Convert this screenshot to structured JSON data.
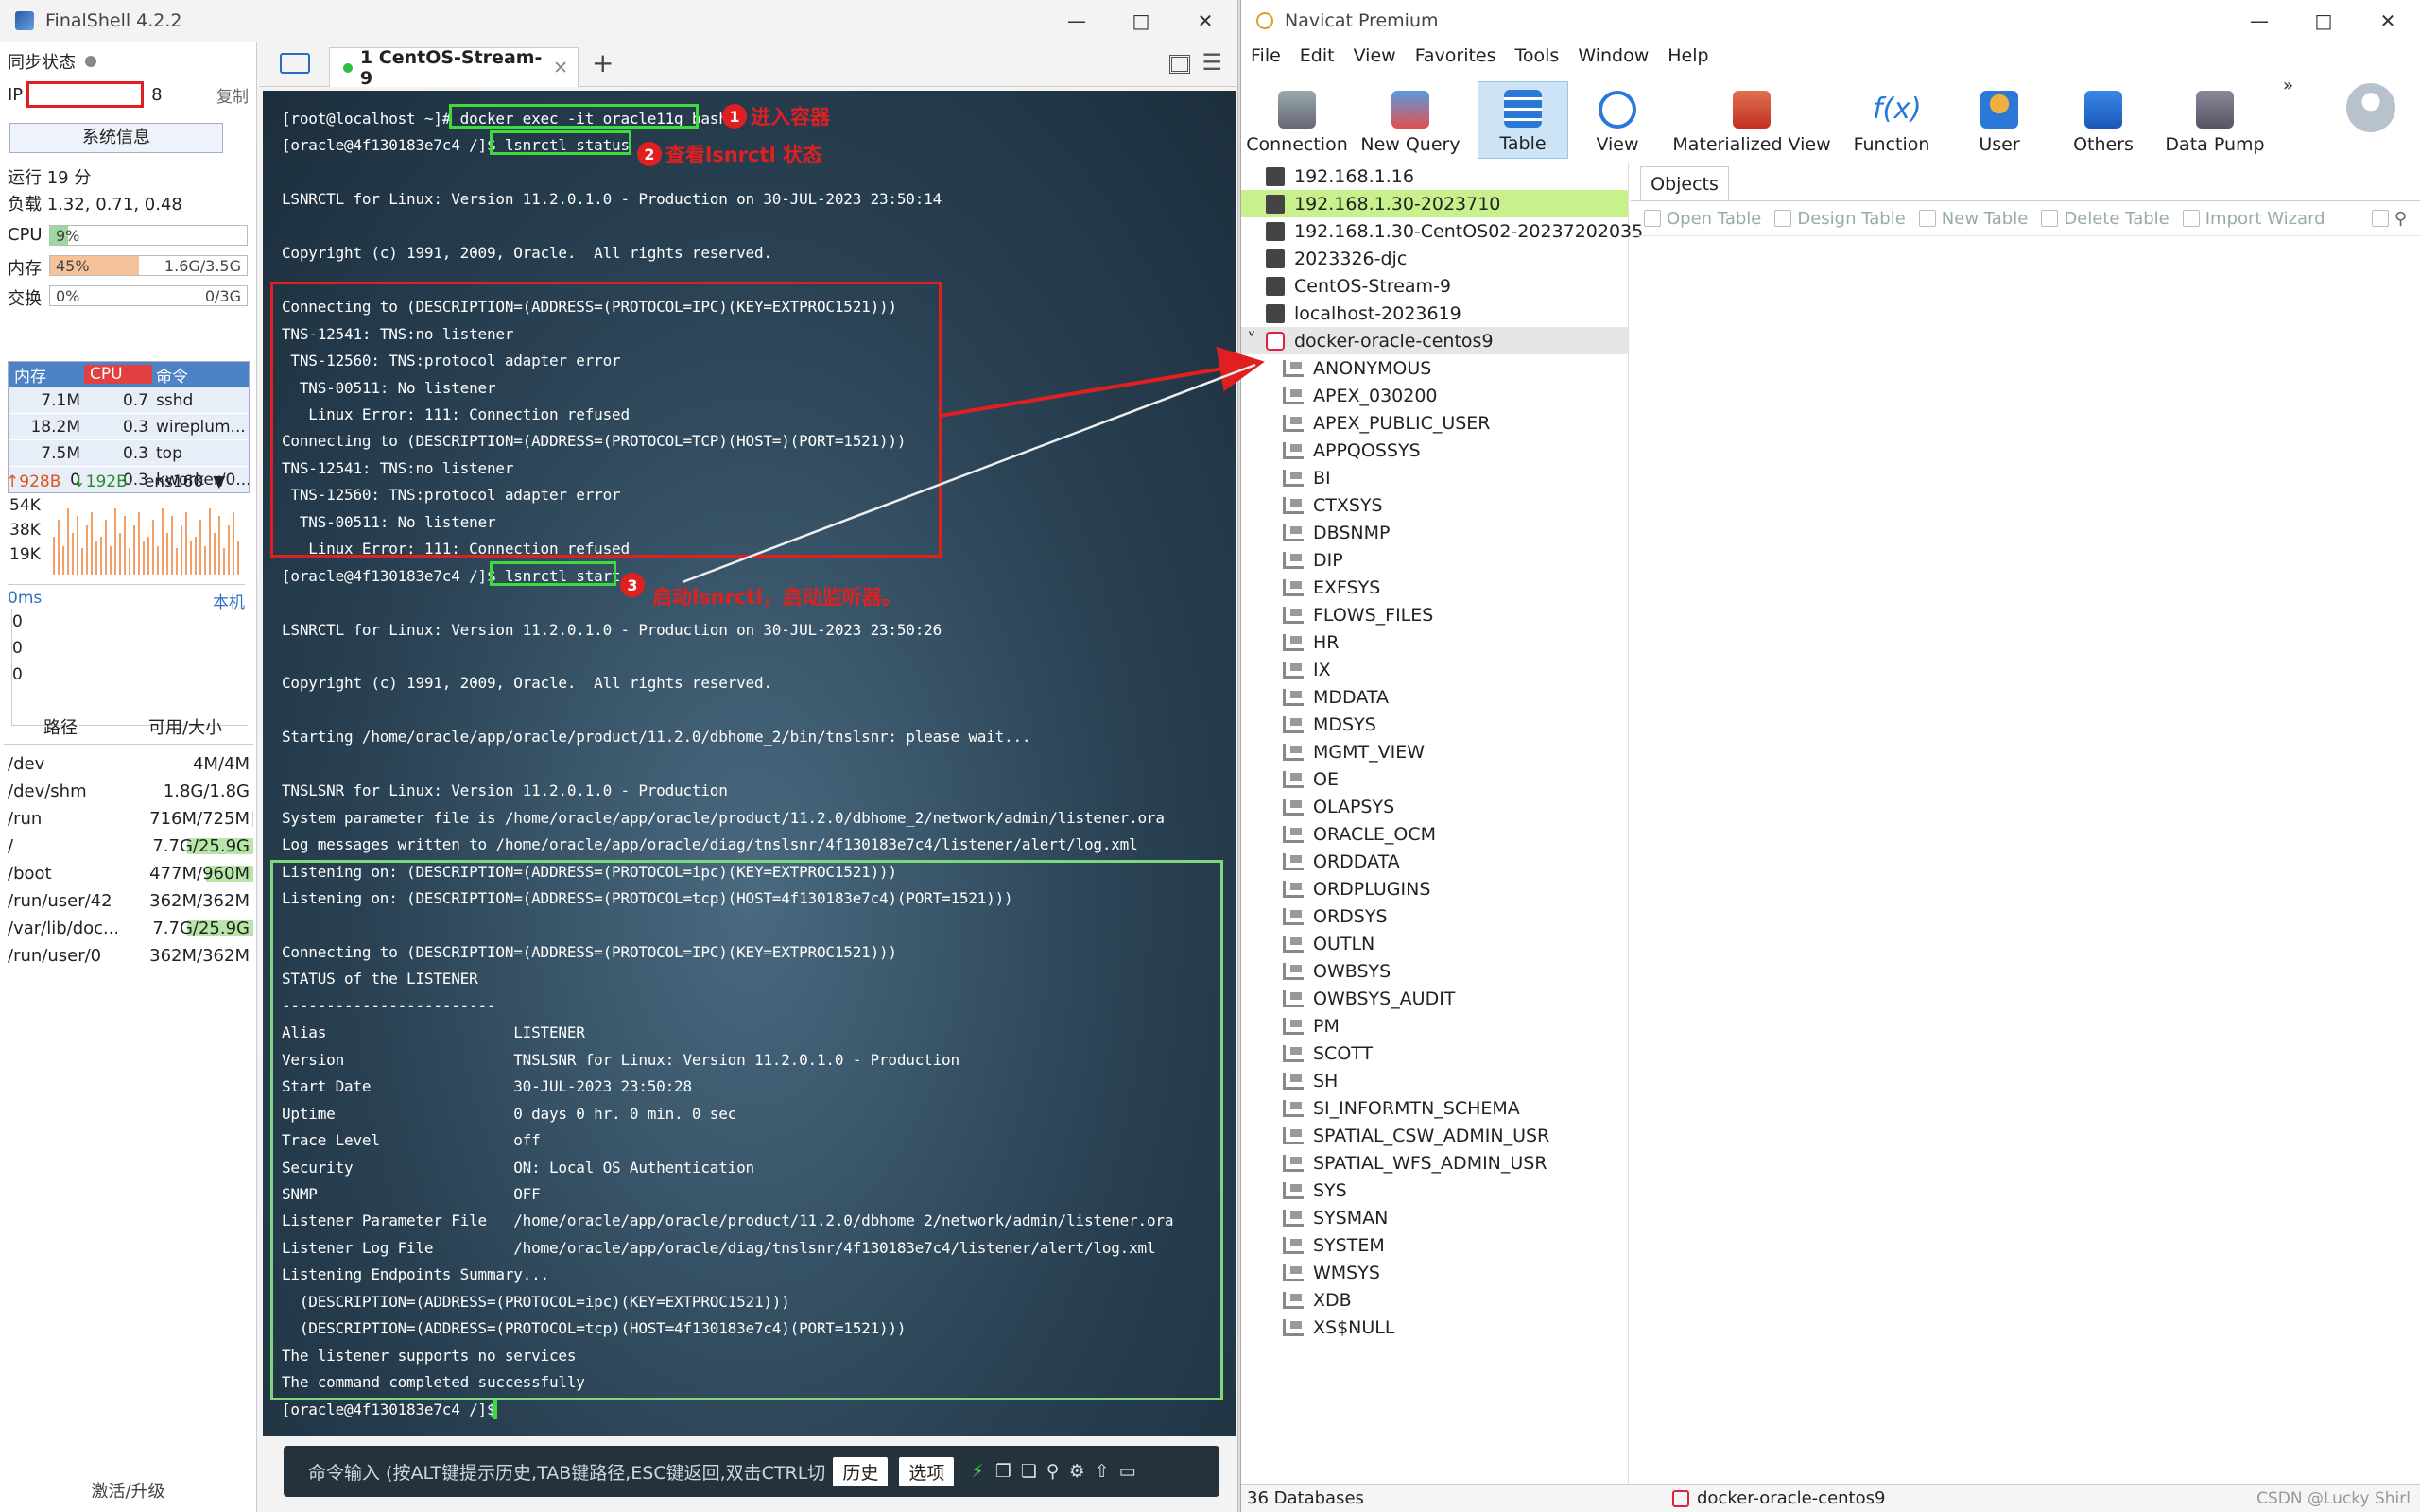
{
  "finalshell": {
    "title": "FinalShell 4.2.2",
    "sync_label": "同步状态",
    "ip_label": "IP",
    "ip_suffix": "8",
    "copy_label": "复制",
    "sysinfo_button": "系统信息",
    "uptime": "运行 19 分",
    "load": "负载 1.32, 0.71, 0.48",
    "cpu": {
      "label": "CPU",
      "value": "9%",
      "fraction": 0.09
    },
    "mem": {
      "label": "内存",
      "value": "45%",
      "size": "1.6G/3.5G",
      "fraction": 0.45
    },
    "swap": {
      "label": "交换",
      "value": "0%",
      "size": "0/3G",
      "fraction": 0
    },
    "proc_headers": [
      "内存",
      "CPU",
      "命令"
    ],
    "processes": [
      {
        "mem": "7.1M",
        "cpu": "0.7",
        "cmd": "sshd"
      },
      {
        "mem": "18.2M",
        "cpu": "0.3",
        "cmd": "wireplum..."
      },
      {
        "mem": "7.5M",
        "cpu": "0.3",
        "cmd": "top"
      },
      {
        "mem": "0",
        "cpu": "0.3",
        "cmd": "kworker/0..."
      }
    ],
    "net": {
      "up": "928B",
      "down": "192B",
      "iface": "ens160",
      "scale": [
        "54K",
        "38K",
        "19K"
      ]
    },
    "ping": {
      "ms": "0ms",
      "host": "本机",
      "vals": [
        "0",
        "0",
        "0"
      ]
    },
    "disk_headers": [
      "路径",
      "可用/大小"
    ],
    "disks": [
      {
        "path": "/dev",
        "size": "4M/4M",
        "used": 0
      },
      {
        "path": "/dev/shm",
        "size": "1.8G/1.8G",
        "used": 0
      },
      {
        "path": "/run",
        "size": "716M/725M",
        "used": 0.01
      },
      {
        "path": "/",
        "size": "7.7G/25.9G",
        "used": 0.7
      },
      {
        "path": "/boot",
        "size": "477M/960M",
        "used": 0.5
      },
      {
        "path": "/run/user/42",
        "size": "362M/362M",
        "used": 0
      },
      {
        "path": "/var/lib/doc...",
        "size": "7.7G/25.9G",
        "used": 0.7
      },
      {
        "path": "/run/user/0",
        "size": "362M/362M",
        "used": 0
      }
    ],
    "activate": "激活/升级",
    "tab_label": "1 CentOS-Stream-9",
    "cmd_placeholder": "命令输入 (按ALT键提示历史,TAB键路径,ESC键返回,双击CTRL切",
    "history_button": "历史",
    "options_button": "选项"
  },
  "terminal_lines": [
    "[root@localhost ~]# docker exec -it oracle11g bash",
    "[oracle@4f130183e7c4 /]$ lsnrctl status",
    "",
    "LSNRCTL for Linux: Version 11.2.0.1.0 - Production on 30-JUL-2023 23:50:14",
    "",
    "Copyright (c) 1991, 2009, Oracle.  All rights reserved.",
    "",
    "Connecting to (DESCRIPTION=(ADDRESS=(PROTOCOL=IPC)(KEY=EXTPROC1521)))",
    "TNS-12541: TNS:no listener",
    " TNS-12560: TNS:protocol adapter error",
    "  TNS-00511: No listener",
    "   Linux Error: 111: Connection refused",
    "Connecting to (DESCRIPTION=(ADDRESS=(PROTOCOL=TCP)(HOST=)(PORT=1521)))",
    "TNS-12541: TNS:no listener",
    " TNS-12560: TNS:protocol adapter error",
    "  TNS-00511: No listener",
    "   Linux Error: 111: Connection refused",
    "[oracle@4f130183e7c4 /]$ lsnrctl start",
    "",
    "LSNRCTL for Linux: Version 11.2.0.1.0 - Production on 30-JUL-2023 23:50:26",
    "",
    "Copyright (c) 1991, 2009, Oracle.  All rights reserved.",
    "",
    "Starting /home/oracle/app/oracle/product/11.2.0/dbhome_2/bin/tnslsnr: please wait...",
    "",
    "TNSLSNR for Linux: Version 11.2.0.1.0 - Production",
    "System parameter file is /home/oracle/app/oracle/product/11.2.0/dbhome_2/network/admin/listener.ora",
    "Log messages written to /home/oracle/app/oracle/diag/tnslsnr/4f130183e7c4/listener/alert/log.xml",
    "Listening on: (DESCRIPTION=(ADDRESS=(PROTOCOL=ipc)(KEY=EXTPROC1521)))",
    "Listening on: (DESCRIPTION=(ADDRESS=(PROTOCOL=tcp)(HOST=4f130183e7c4)(PORT=1521)))",
    "",
    "Connecting to (DESCRIPTION=(ADDRESS=(PROTOCOL=IPC)(KEY=EXTPROC1521)))",
    "STATUS of the LISTENER",
    "------------------------",
    "Alias                     LISTENER",
    "Version                   TNSLSNR for Linux: Version 11.2.0.1.0 - Production",
    "Start Date                30-JUL-2023 23:50:28",
    "Uptime                    0 days 0 hr. 0 min. 0 sec",
    "Trace Level               off",
    "Security                  ON: Local OS Authentication",
    "SNMP                      OFF",
    "Listener Parameter File   /home/oracle/app/oracle/product/11.2.0/dbhome_2/network/admin/listener.ora",
    "Listener Log File         /home/oracle/app/oracle/diag/tnslsnr/4f130183e7c4/listener/alert/log.xml",
    "Listening Endpoints Summary...",
    "  (DESCRIPTION=(ADDRESS=(PROTOCOL=ipc)(KEY=EXTPROC1521)))",
    "  (DESCRIPTION=(ADDRESS=(PROTOCOL=tcp)(HOST=4f130183e7c4)(PORT=1521)))",
    "The listener supports no services",
    "The command completed successfully",
    "[oracle@4f130183e7c4 /]$"
  ],
  "annotations": {
    "step1": "1",
    "step1_text": "进入容器",
    "step2": "2",
    "step2_text": "查看lsnrctl 状态",
    "step3": "3",
    "step3_text": "启动lsnrctl，启动监听器。"
  },
  "colors": {
    "annotation_red": "#e02020",
    "annotation_green": "#3cdc3c",
    "success_green": "#7bd87b",
    "selection_green": "#c8f08c"
  },
  "navicat": {
    "title": "Navicat Premium",
    "menu": [
      "File",
      "Edit",
      "View",
      "Favorites",
      "Tools",
      "Window",
      "Help"
    ],
    "toolbar": [
      "Connection",
      "New Query",
      "Table",
      "View",
      "Materialized View",
      "Function",
      "User",
      "Others",
      "Data Pump"
    ],
    "connections": [
      "192.168.1.16",
      "192.168.1.30-2023710",
      "192.168.1.30-CentOS02-20237202035",
      "2023326-djc",
      "CentOS-Stream-9",
      "localhost-2023619",
      "docker-oracle-centos9"
    ],
    "schemas": [
      "ANONYMOUS",
      "APEX_030200",
      "APEX_PUBLIC_USER",
      "APPQOSSYS",
      "BI",
      "CTXSYS",
      "DBSNMP",
      "DIP",
      "EXFSYS",
      "FLOWS_FILES",
      "HR",
      "IX",
      "MDDATA",
      "MDSYS",
      "MGMT_VIEW",
      "OE",
      "OLAPSYS",
      "ORACLE_OCM",
      "ORDDATA",
      "ORDPLUGINS",
      "ORDSYS",
      "OUTLN",
      "OWBSYS",
      "OWBSYS_AUDIT",
      "PM",
      "SCOTT",
      "SH",
      "SI_INFORMTN_SCHEMA",
      "SPATIAL_CSW_ADMIN_USR",
      "SPATIAL_WFS_ADMIN_USR",
      "SYS",
      "SYSMAN",
      "SYSTEM",
      "WMSYS",
      "XDB",
      "XS$NULL"
    ],
    "objects_tab": "Objects",
    "obj_actions": [
      "Open Table",
      "Design Table",
      "New Table",
      "Delete Table",
      "Import Wizard"
    ],
    "status_left": "36 Databases",
    "status_conn": "docker-oracle-centos9",
    "watermark": "CSDN @Lucky Shirl"
  }
}
